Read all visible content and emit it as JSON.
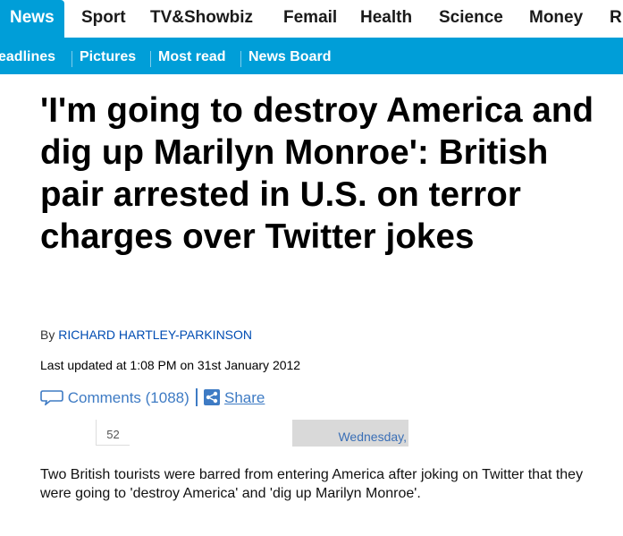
{
  "nav_primary": {
    "items": [
      {
        "label": "News",
        "active": true
      },
      {
        "label": "Sport"
      },
      {
        "label": "TV&Showbiz"
      },
      {
        "label": "Femail"
      },
      {
        "label": "Health"
      },
      {
        "label": "Science"
      },
      {
        "label": "Money"
      },
      {
        "label": "R"
      }
    ]
  },
  "nav_secondary": {
    "items": [
      {
        "label": "eadlines"
      },
      {
        "label": "Pictures"
      },
      {
        "label": "Most read"
      },
      {
        "label": "News Board"
      }
    ]
  },
  "article": {
    "headline": "'I'm going to destroy America and dig up Marilyn Monroe': British pair arrested in U.S. on terror charges over Twitter jokes",
    "byline_prefix": "By",
    "author": "RICHARD HARTLEY-PARKINSON",
    "last_updated": "Last updated at 1:08 PM on 31st January 2012",
    "comments_label": "Comments (1088)",
    "share_label": "Share",
    "share_count": "52",
    "date_widget": "Wednesday,",
    "body_text": "Two British tourists were barred from entering America after joking on Twitter that they were going to 'destroy America' and 'dig up Marilyn Monroe'."
  },
  "colors": {
    "brand_blue": "#009ed8",
    "link_blue": "#3e7bc4",
    "author_blue": "#004db3"
  },
  "icons": {
    "comments": "speech-bubble-icon",
    "share": "share-icon"
  }
}
